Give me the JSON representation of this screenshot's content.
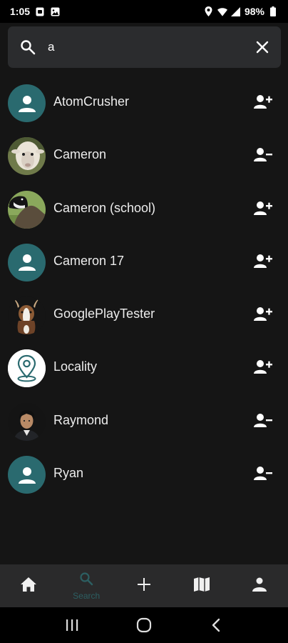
{
  "status_bar": {
    "time": "1:05",
    "battery": "98%",
    "icons": [
      "sim-icon",
      "photo-icon",
      "location-icon",
      "wifi-icon",
      "signal-icon",
      "battery-icon"
    ]
  },
  "search": {
    "value": "a",
    "placeholder": ""
  },
  "users": [
    {
      "name": "AtomCrusher",
      "avatar": "default-person-icon",
      "action": "add-friend-icon"
    },
    {
      "name": "Cameron",
      "avatar": "sheep-photo",
      "action": "remove-friend-icon"
    },
    {
      "name": "Cameron (school)",
      "avatar": "goose-photo",
      "action": "add-friend-icon"
    },
    {
      "name": "Cameron 17",
      "avatar": "default-person-icon",
      "action": "add-friend-icon"
    },
    {
      "name": "GooglePlayTester",
      "avatar": "goat-photo",
      "action": "add-friend-icon"
    },
    {
      "name": "Locality",
      "avatar": "locality-logo",
      "action": "add-friend-icon"
    },
    {
      "name": "Raymond",
      "avatar": "person-photo",
      "action": "remove-friend-icon"
    },
    {
      "name": "Ryan",
      "avatar": "default-person-icon",
      "action": "remove-friend-icon"
    }
  ],
  "bottom_nav": {
    "items": [
      {
        "icon": "home-icon",
        "label": ""
      },
      {
        "icon": "search-icon",
        "label": "Search",
        "active": true
      },
      {
        "icon": "plus-icon",
        "label": ""
      },
      {
        "icon": "map-icon",
        "label": ""
      },
      {
        "icon": "profile-icon",
        "label": ""
      }
    ]
  },
  "system_nav": [
    "recents-icon",
    "home-circle-icon",
    "back-icon"
  ],
  "colors": {
    "accent": "#2a6a6f",
    "background": "#151515",
    "search_bg": "#2b2c2e",
    "nav_bg": "#2a2a2b"
  }
}
